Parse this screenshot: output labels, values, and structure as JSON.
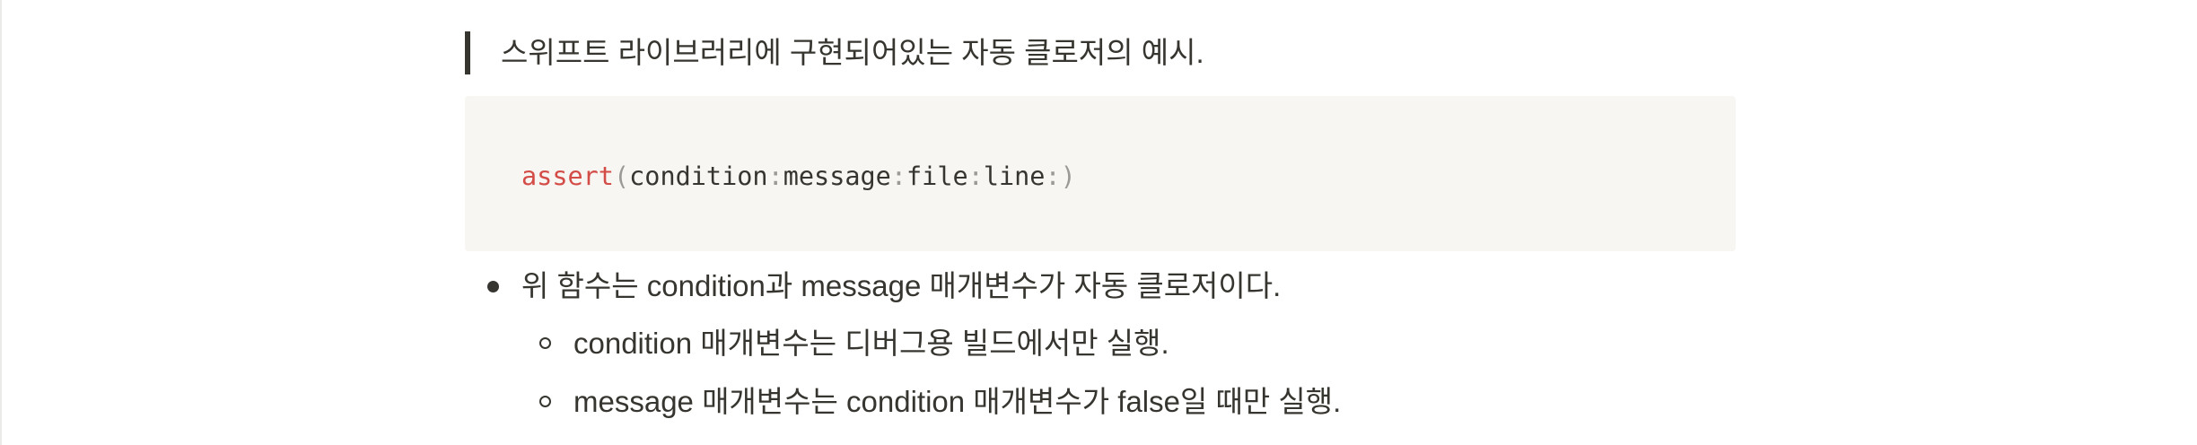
{
  "quote": {
    "text": "스위프트 라이브러리에 구현되어있는 자동 클로저의 예시."
  },
  "code": {
    "function_name": "assert",
    "open_paren": "(",
    "close_paren": ")",
    "params": [
      "condition",
      "message",
      "file",
      "line"
    ],
    "separator": ":"
  },
  "list": {
    "main_item": "위 함수는 condition과 message 매개변수가 자동 클로저이다.",
    "sub_items": [
      "condition 매개변수는 디버그용 빌드에서만 실행.",
      "message 매개변수는 condition 매개변수가 false일 때만 실행."
    ]
  }
}
